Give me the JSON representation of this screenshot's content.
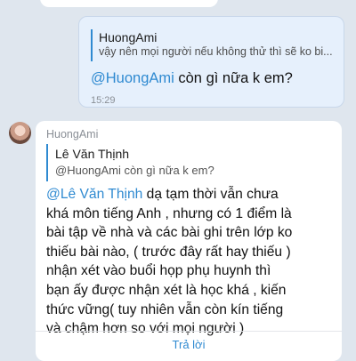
{
  "outgoing": {
    "quote": {
      "name": "HuongAmi",
      "text": "vậy nên mọi người nếu không thử thì sẽ ko bi..."
    },
    "mention": "@HuongAmi",
    "text": " còn gì nữa k em?",
    "time": "15:29"
  },
  "incoming": {
    "sender": "HuongAmi",
    "quote": {
      "name": "Lê Văn Thịnh",
      "text": "@HuongAmi còn gì nữa k em?"
    },
    "mention": "@Lê Văn Thịnh",
    "first_line_rest": " dạ tạm thời vẫn chưa",
    "lines": [
      "khá môn tiếng Anh , nhưng có 1 điểm là",
      "bài tập về nhà và các bài ghi trên lớp ko",
      "thiếu bài nào, ( trước đây rất hay thiếu )",
      "nhận xét vào buổi họp phụ huynh thì",
      "bạn ấy được nhận xét là học khá , kiến",
      "thức vững( tuy nhiên vẫn còn kín tiếng",
      "và chậm hơn so với mọi người )"
    ],
    "reply_label": "Trả lời"
  }
}
